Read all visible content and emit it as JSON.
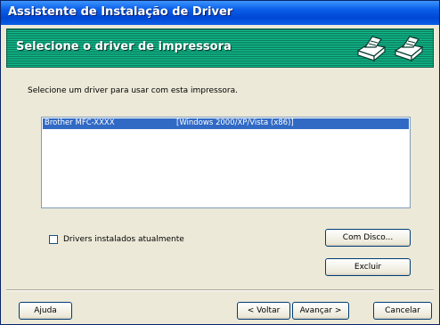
{
  "window": {
    "title": "Assistente de Instalação de Driver"
  },
  "header": {
    "title": "Selecione o driver de impressora",
    "icons": [
      "printer-icon",
      "printer-icon"
    ]
  },
  "instruction": "Selecione um driver para usar com esta impressora.",
  "driver_list": {
    "items": [
      {
        "name": "Brother   MFC-XXXX",
        "os": "[Windows 2000/XP/Vista (x86)]",
        "selected": true
      }
    ]
  },
  "options": {
    "installed_drivers_label": "Drivers instalados atualmente",
    "installed_drivers_checked": false
  },
  "buttons": {
    "com_disco": "Com Disco...",
    "excluir": "Excluir",
    "ajuda": "Ajuda",
    "voltar": "< Voltar",
    "avancar": "Avançar >",
    "cancelar": "Cancelar"
  },
  "colors": {
    "title_bar": "#0a5fe8",
    "header_green": "#10bc8a",
    "selection": "#316ac5"
  }
}
